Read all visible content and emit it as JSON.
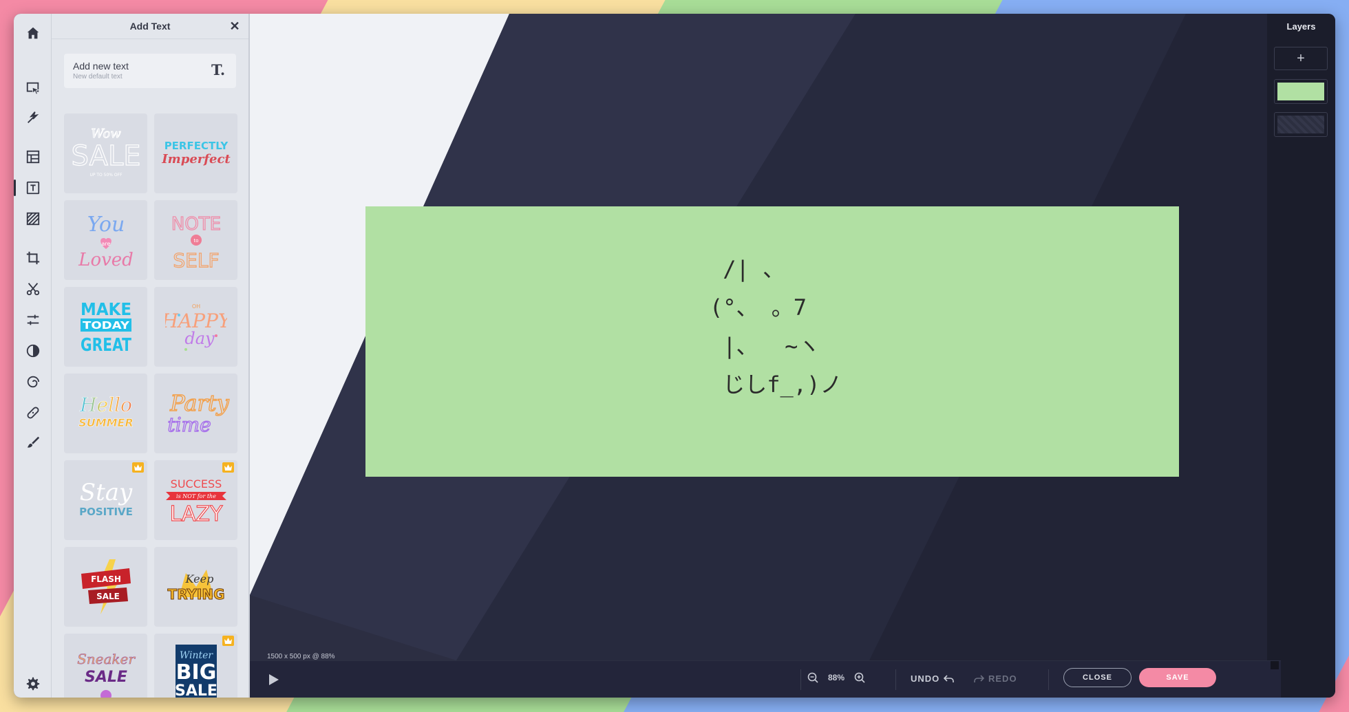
{
  "colors": {
    "stripes": [
      "#f48aa5",
      "#f9dfa0",
      "#a8dd97",
      "#86aef3",
      "#f48aa5",
      "#f9dfa0",
      "#a8dd97",
      "#86aef3"
    ],
    "artboard": "#b1e0a3",
    "save_accent": "#f48aa5",
    "premium_badge": "#f5b220"
  },
  "rail": {
    "items": [
      {
        "icon": "home-icon"
      },
      {
        "icon": "pointer-select-icon"
      },
      {
        "icon": "magic-wand-icon"
      },
      {
        "icon": "layout-template-icon"
      },
      {
        "icon": "text-tool-icon",
        "active": true
      },
      {
        "icon": "texture-pattern-icon"
      },
      {
        "icon": "crop-icon"
      },
      {
        "icon": "scissors-icon"
      },
      {
        "icon": "sliders-adjust-icon"
      },
      {
        "icon": "contrast-icon"
      },
      {
        "icon": "spiral-effects-icon"
      },
      {
        "icon": "bandage-retouch-icon"
      },
      {
        "icon": "brush-icon"
      },
      {
        "icon": "gear-icon"
      }
    ]
  },
  "panel": {
    "title": "Add Text",
    "add_new": {
      "title": "Add new text",
      "subtitle": "New default text",
      "icon": "text-t-icon"
    },
    "templates": [
      {
        "name": "wow-sale",
        "premium": false
      },
      {
        "name": "perfectly-imperfect",
        "premium": false
      },
      {
        "name": "you-are-loved",
        "premium": false
      },
      {
        "name": "note-to-self",
        "premium": false
      },
      {
        "name": "make-today-great",
        "premium": false
      },
      {
        "name": "oh-happy-day",
        "premium": false
      },
      {
        "name": "hello-summer",
        "premium": false
      },
      {
        "name": "party-time",
        "premium": false
      },
      {
        "name": "stay-positive",
        "premium": true
      },
      {
        "name": "success-is-not-for-the-lazy",
        "premium": true
      },
      {
        "name": "flash-sale",
        "premium": false
      },
      {
        "name": "keep-trying",
        "premium": false
      },
      {
        "name": "sneaker-sale",
        "premium": false
      },
      {
        "name": "winter-big-sale",
        "premium": true
      }
    ]
  },
  "canvas": {
    "ascii_lines": [
      " /| 、",
      "(°、 。7",
      " |、  ~ヽ",
      " じしf_,)ノ"
    ]
  },
  "layers": {
    "title": "Layers",
    "add_label": "+"
  },
  "bottom": {
    "canvas_info": "1500 x 500 px @ 88%",
    "zoom_value": "88%",
    "undo_label": "UNDO",
    "redo_label": "REDO",
    "close_label": "CLOSE",
    "save_label": "SAVE"
  }
}
